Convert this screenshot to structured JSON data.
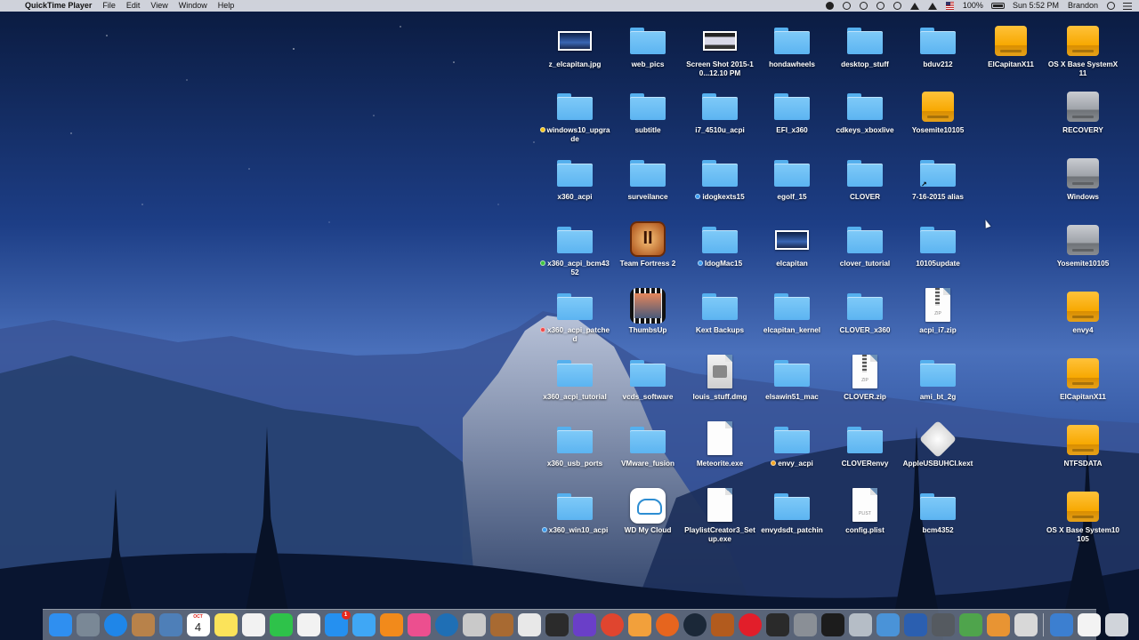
{
  "menubar": {
    "app_name": "QuickTime Player",
    "menus": [
      "File",
      "Edit",
      "View",
      "Window",
      "Help"
    ],
    "battery": "100%",
    "clock": "Sun 5:52 PM",
    "user": "Brandon"
  },
  "desktop": {
    "columns": [
      [
        {
          "label": "z_elcapitan.jpg",
          "type": "image"
        },
        {
          "label": "windows10_upgrade",
          "type": "folder",
          "tag": "#f5c518"
        },
        {
          "label": "x360_acpi",
          "type": "folder"
        },
        {
          "label": "x360_acpi_bcm4352",
          "type": "folder",
          "tag": "#3ec33e"
        },
        {
          "label": "x360_acpi_patched",
          "type": "folder",
          "tag": "#ef4a4a"
        },
        {
          "label": "x360_acpi_tutorial",
          "type": "folder"
        },
        {
          "label": "x360_usb_ports",
          "type": "folder"
        },
        {
          "label": "x360_win10_acpi",
          "type": "folder",
          "tag": "#3a9cf0"
        }
      ],
      [
        {
          "label": "web_pics",
          "type": "folder"
        },
        {
          "label": "subtitle",
          "type": "folder"
        },
        {
          "label": "surveilance",
          "type": "folder"
        },
        {
          "label": "Team Fortress 2",
          "type": "app-tf2"
        },
        {
          "label": "ThumbsUp",
          "type": "app-film"
        },
        {
          "label": "vcds_software",
          "type": "folder"
        },
        {
          "label": "VMware_fusion",
          "type": "folder"
        },
        {
          "label": "WD My Cloud",
          "type": "app-cloud"
        }
      ],
      [
        {
          "label": "Screen Shot 2015-10...12.10 PM",
          "type": "screenshot"
        },
        {
          "label": "i7_4510u_acpi",
          "type": "folder"
        },
        {
          "label": "idogkexts15",
          "type": "folder",
          "tag": "#3a9cf0"
        },
        {
          "label": "IdogMac15",
          "type": "folder",
          "tag": "#3a9cf0"
        },
        {
          "label": "Kext Backups",
          "type": "folder"
        },
        {
          "label": "louis_stuff.dmg",
          "type": "dmg"
        },
        {
          "label": "Meteorite.exe",
          "type": "doc"
        },
        {
          "label": "PlaylistCreator3_Setup.exe",
          "type": "doc"
        }
      ],
      [
        {
          "label": "hondawheels",
          "type": "folder"
        },
        {
          "label": "EFI_x360",
          "type": "folder"
        },
        {
          "label": "egolf_15",
          "type": "folder"
        },
        {
          "label": "elcapitan",
          "type": "image"
        },
        {
          "label": "elcapitan_kernel",
          "type": "folder"
        },
        {
          "label": "elsawin51_mac",
          "type": "folder"
        },
        {
          "label": "envy_acpi",
          "type": "folder",
          "tag": "#f5a623"
        },
        {
          "label": "envydsdt_patchin",
          "type": "folder"
        }
      ],
      [
        {
          "label": "desktop_stuff",
          "type": "folder"
        },
        {
          "label": "cdkeys_xboxlive",
          "type": "folder"
        },
        {
          "label": "CLOVER",
          "type": "folder"
        },
        {
          "label": "clover_tutorial",
          "type": "folder"
        },
        {
          "label": "CLOVER_x360",
          "type": "folder"
        },
        {
          "label": "CLOVER.zip",
          "type": "zip"
        },
        {
          "label": "CLOVERenvy",
          "type": "folder"
        },
        {
          "label": "config.plist",
          "type": "plist"
        }
      ],
      [
        {
          "label": "bduv212",
          "type": "folder"
        },
        {
          "label": "Yosemite10105",
          "type": "drive-orange"
        },
        {
          "label": "7-16-2015 alias",
          "type": "folder-alias"
        },
        {
          "label": "10105update",
          "type": "folder"
        },
        {
          "label": "acpi_i7.zip",
          "type": "zip"
        },
        {
          "label": "ami_bt_2g",
          "type": "folder"
        },
        {
          "label": "AppleUSBUHCI.kext",
          "type": "kext"
        },
        {
          "label": "bcm4352",
          "type": "folder"
        }
      ],
      [
        {
          "label": "OS X Base SystemX11",
          "type": "drive-orange"
        },
        {
          "label": "RECOVERY",
          "type": "drive-gray"
        },
        {
          "label": "Windows",
          "type": "drive-gray"
        },
        {
          "label": "Yosemite10105",
          "type": "drive-gray"
        },
        {
          "label": "envy4",
          "type": "drive-orange"
        },
        {
          "label": "ElCapitanX11",
          "type": "drive-orange"
        },
        {
          "label": "NTFSDATA",
          "type": "drive-orange"
        },
        {
          "label": "OS X Base System10105",
          "type": "drive-orange"
        }
      ],
      [
        {
          "label": "ElCapitanX11",
          "type": "drive-orange"
        }
      ]
    ]
  },
  "dock": {
    "calendar": {
      "month": "OCT",
      "day": "4"
    },
    "app_store_badge": "1",
    "items": [
      {
        "name": "finder-icon",
        "color": "#2f8ff0"
      },
      {
        "name": "launchpad-icon",
        "color": "#7a8896"
      },
      {
        "name": "safari-icon",
        "color": "#1f86e8"
      },
      {
        "name": "contacts-icon",
        "color": "#b8824a"
      },
      {
        "name": "preview-icon",
        "color": "#4e7fb8"
      },
      {
        "name": "calendar-icon",
        "color": "#ffffff"
      },
      {
        "name": "notes-icon",
        "color": "#fbe35a"
      },
      {
        "name": "reminders-icon",
        "color": "#f2f2f2"
      },
      {
        "name": "facetime-icon",
        "color": "#2ec24a"
      },
      {
        "name": "textedit-icon",
        "color": "#f2f2f2"
      },
      {
        "name": "app-store-icon",
        "color": "#2590f0"
      },
      {
        "name": "messages-icon",
        "color": "#3fa7f5"
      },
      {
        "name": "ibooks-icon",
        "color": "#f28a1b"
      },
      {
        "name": "itunes-icon",
        "color": "#ec4f8f"
      },
      {
        "name": "edge-icon",
        "color": "#1f6fb5"
      },
      {
        "name": "script-editor-icon",
        "color": "#c9c9c9"
      },
      {
        "name": "books-app-icon",
        "color": "#a86a32"
      },
      {
        "name": "pages-icon",
        "color": "#e8e8e8"
      },
      {
        "name": "imovie-star-icon",
        "color": "#2b2b2b"
      },
      {
        "name": "imovie-icon",
        "color": "#6a3fc8"
      },
      {
        "name": "chrome-icon",
        "color": "#e0452f"
      },
      {
        "name": "photos-icon",
        "color": "#f2a03b"
      },
      {
        "name": "firefox-icon",
        "color": "#e6651e"
      },
      {
        "name": "steam-icon",
        "color": "#1b2838"
      },
      {
        "name": "team-fortress-icon",
        "color": "#b25b1e"
      },
      {
        "name": "opera-icon",
        "color": "#e21e2a"
      },
      {
        "name": "cinema-icon",
        "color": "#2a2a2a"
      },
      {
        "name": "system-prefs-icon",
        "color": "#8a8f96"
      },
      {
        "name": "terminal-icon",
        "color": "#1c1c1c"
      },
      {
        "name": "disk-utility-icon",
        "color": "#b5bdc6"
      },
      {
        "name": "activity-monitor-icon",
        "color": "#4a93d8"
      },
      {
        "name": "word-icon",
        "color": "#2b5fb0"
      },
      {
        "name": "console-icon",
        "color": "#555a60"
      },
      {
        "name": "grapher-icon",
        "color": "#4fa44c"
      },
      {
        "name": "pencil-app-icon",
        "color": "#e89433"
      },
      {
        "name": "scripts-icon",
        "color": "#d8d8d8"
      }
    ],
    "trailing": [
      {
        "name": "downloads-stack-icon",
        "color": "#3c7fd0"
      },
      {
        "name": "documents-stack-icon",
        "color": "#f3f3f3"
      },
      {
        "name": "trash-icon",
        "color": "#d0d4da"
      }
    ]
  }
}
